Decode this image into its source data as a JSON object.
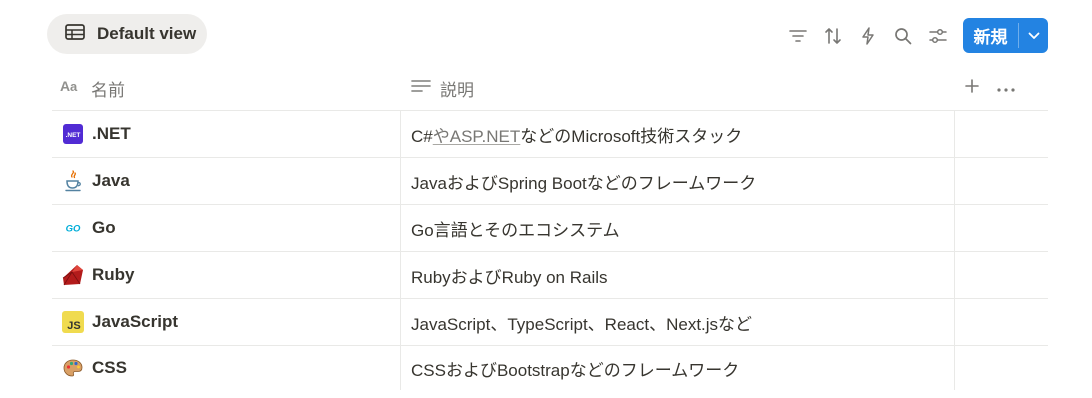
{
  "view_tab": {
    "label": "Default view",
    "icon": "table-icon"
  },
  "toolbar": {
    "icons": [
      "filter-icon",
      "sort-icon",
      "automation-icon",
      "search-icon",
      "settings-icon"
    ],
    "new_button": {
      "label": "新規",
      "caret_icon": "chevron-down-icon"
    }
  },
  "columns": {
    "name": {
      "label": "名前",
      "icon": "text-type-icon"
    },
    "desc": {
      "label": "説明",
      "icon": "lines-icon"
    },
    "add_icon": "plus-icon",
    "more_icon": "more-icon"
  },
  "rows": [
    {
      "name": ".NET",
      "icon": "dotnet-icon",
      "desc_parts": [
        "C#",
        "やASP.NET",
        "などのMicrosoft技術スタック"
      ]
    },
    {
      "name": "Java",
      "icon": "java-icon",
      "desc": "JavaおよびSpring Bootなどのフレームワーク"
    },
    {
      "name": "Go",
      "icon": "go-icon",
      "desc": "Go言語とそのエコシステム"
    },
    {
      "name": "Ruby",
      "icon": "ruby-icon",
      "desc": "RubyおよびRuby on Rails"
    },
    {
      "name": "JavaScript",
      "icon": "javascript-icon",
      "desc": "JavaScript、TypeScript、React、Next.jsなど"
    },
    {
      "name": "CSS",
      "icon": "palette-icon",
      "desc": "CSSおよびBootstrapなどのフレームワーク"
    }
  ],
  "colors": {
    "accent": "#2383e2",
    "border": "#e9e9e7",
    "muted": "#787774",
    "text": "#37352f"
  }
}
